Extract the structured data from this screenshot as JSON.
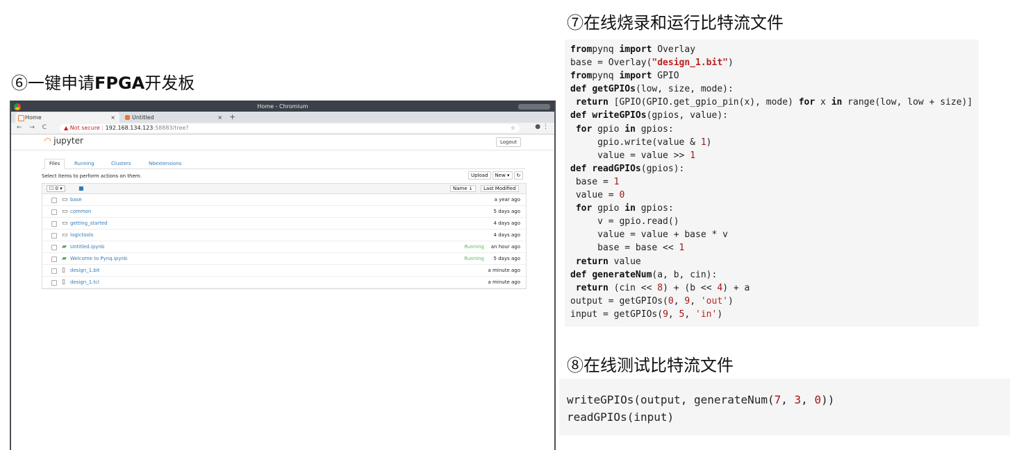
{
  "headings": {
    "step6": "⑥一键申请",
    "step6_bold": "FPGA",
    "step6_tail": "开发板",
    "step7": "⑦在线烧录和运行比特流文件",
    "step8": "⑧在线测试比特流文件"
  },
  "browser": {
    "window_title": "Home - Chromium",
    "tabs": [
      {
        "label": "Home",
        "close": "×"
      },
      {
        "label": "Untitled",
        "close": "×"
      }
    ],
    "new_tab": "+",
    "nav": "← → C",
    "security": "▲ Not secure",
    "url_host": "192.168.134.123",
    "url_path": ":58883/tree?"
  },
  "jupyter": {
    "logo": "jupyter",
    "logout": "Logout",
    "tabs": [
      "Files",
      "Running",
      "Clusters",
      "Nbextensions"
    ],
    "select_info": "Select items to perform actions on them.",
    "upload": "Upload",
    "new": "New ▾",
    "refresh": "↻",
    "select_count": "0",
    "sort_name": "Name ↓",
    "sort_modified": "Last Modified",
    "files": [
      {
        "name": "base",
        "type": "folder",
        "status": "",
        "modified": "a year ago"
      },
      {
        "name": "common",
        "type": "folder",
        "status": "",
        "modified": "5 days ago"
      },
      {
        "name": "getting_started",
        "type": "folder",
        "status": "",
        "modified": "4 days ago"
      },
      {
        "name": "logictools",
        "type": "folder",
        "status": "",
        "modified": "4 days ago"
      },
      {
        "name": "Untitled.ipynb",
        "type": "notebook",
        "status": "Running",
        "modified": "an hour ago"
      },
      {
        "name": "Welcome to Pynq.ipynb",
        "type": "notebook",
        "status": "Running",
        "modified": "5 days ago"
      },
      {
        "name": "design_1.bit",
        "type": "file",
        "status": "",
        "modified": "a minute ago"
      },
      {
        "name": "design_1.tcl",
        "type": "file",
        "status": "",
        "modified": "a minute ago"
      }
    ]
  },
  "code1": [
    [
      [
        "kw",
        "from"
      ],
      [
        "",
        "pynq "
      ],
      [
        "kw",
        "import"
      ],
      [
        "",
        " Overlay"
      ]
    ],
    [
      [
        "",
        "base = Overlay("
      ],
      [
        "st",
        "\"design_1.bit\""
      ],
      [
        "",
        ")"
      ]
    ],
    [
      [
        "kw",
        "from"
      ],
      [
        "",
        "pynq "
      ],
      [
        "kw",
        "import"
      ],
      [
        "",
        " GPIO"
      ]
    ],
    [
      [
        "kw",
        "def "
      ],
      [
        "fn",
        "getGPIOs"
      ],
      [
        "",
        "(low, size, mode):"
      ]
    ],
    [
      [
        "",
        " "
      ],
      [
        "kw",
        "return"
      ],
      [
        "",
        " [GPIO(GPIO.get_gpio_pin(x), mode) "
      ],
      [
        "kw",
        "for"
      ],
      [
        "",
        " x "
      ],
      [
        "kw",
        "in"
      ],
      [
        "",
        " range(low, low + size)]"
      ]
    ],
    [
      [
        "kw",
        "def "
      ],
      [
        "fn",
        "writeGPIOs"
      ],
      [
        "",
        "(gpios, value):"
      ]
    ],
    [
      [
        "",
        " "
      ],
      [
        "kw",
        "for"
      ],
      [
        "",
        " gpio "
      ],
      [
        "kw",
        "in"
      ],
      [
        "",
        " gpios:"
      ]
    ],
    [
      [
        "",
        "     gpio.write(value & "
      ],
      [
        "nm",
        "1"
      ],
      [
        "",
        ")"
      ]
    ],
    [
      [
        "",
        "     value = value >> "
      ],
      [
        "nm",
        "1"
      ]
    ],
    [
      [
        "kw",
        "def "
      ],
      [
        "fn",
        "readGPIOs"
      ],
      [
        "",
        "(gpios):"
      ]
    ],
    [
      [
        "",
        " base = "
      ],
      [
        "nm",
        "1"
      ]
    ],
    [
      [
        "",
        " value = "
      ],
      [
        "nm",
        "0"
      ]
    ],
    [
      [
        "",
        " "
      ],
      [
        "kw",
        "for"
      ],
      [
        "",
        " gpio "
      ],
      [
        "kw",
        "in"
      ],
      [
        "",
        " gpios:"
      ]
    ],
    [
      [
        "",
        "     v = gpio.read()"
      ]
    ],
    [
      [
        "",
        "     value = value + base * v"
      ]
    ],
    [
      [
        "",
        "     base = base << "
      ],
      [
        "nm",
        "1"
      ]
    ],
    [
      [
        "",
        " "
      ],
      [
        "kw",
        "return"
      ],
      [
        "",
        " value"
      ]
    ],
    [
      [
        "kw",
        "def "
      ],
      [
        "fn",
        "generateNum"
      ],
      [
        "",
        "(a, b, cin):"
      ]
    ],
    [
      [
        "",
        " "
      ],
      [
        "kw",
        "return"
      ],
      [
        "",
        " (cin << "
      ],
      [
        "nm",
        "8"
      ],
      [
        "",
        ") + (b << "
      ],
      [
        "nm",
        "4"
      ],
      [
        "",
        ") + a"
      ]
    ],
    [
      [
        "",
        "output = getGPIOs("
      ],
      [
        "nm",
        "0"
      ],
      [
        "",
        ", "
      ],
      [
        "nm",
        "9"
      ],
      [
        "",
        ", "
      ],
      [
        "st2",
        "'out'"
      ],
      [
        "",
        ")"
      ]
    ],
    [
      [
        "",
        "input = getGPIOs("
      ],
      [
        "nm",
        "9"
      ],
      [
        "",
        ", "
      ],
      [
        "nm",
        "5"
      ],
      [
        "",
        ", "
      ],
      [
        "st2",
        "'in'"
      ],
      [
        "",
        ")"
      ]
    ]
  ],
  "code2": [
    [
      [
        "",
        "writeGPIOs(output, generateNum("
      ],
      [
        "nm",
        "7"
      ],
      [
        "",
        ", "
      ],
      [
        "nm",
        "3"
      ],
      [
        "",
        ", "
      ],
      [
        "nm",
        "0"
      ],
      [
        "",
        "))"
      ]
    ],
    [
      [
        "",
        "readGPIOs(input)"
      ]
    ]
  ]
}
